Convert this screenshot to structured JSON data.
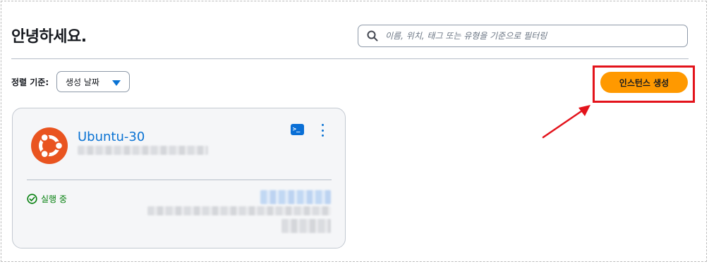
{
  "header": {
    "greeting": "안녕하세요."
  },
  "search": {
    "placeholder": "이름, 위치, 태그 또는 유형을 기준으로 필터링",
    "value": "",
    "icon": "search-icon"
  },
  "sort": {
    "label": "정렬 기준:",
    "selected": "생성 날짜",
    "icon": "caret-down-icon"
  },
  "actions": {
    "create_label": "인스턴스 생성"
  },
  "instances": [
    {
      "name": "Ubuntu-30",
      "os": "ubuntu-logo",
      "status": "실행 중",
      "status_color": "#037f0c"
    }
  ],
  "colors": {
    "accent": "#ff9900",
    "link": "#0972d3",
    "ubuntu": "#e95420",
    "annotation": "#e3131b"
  }
}
